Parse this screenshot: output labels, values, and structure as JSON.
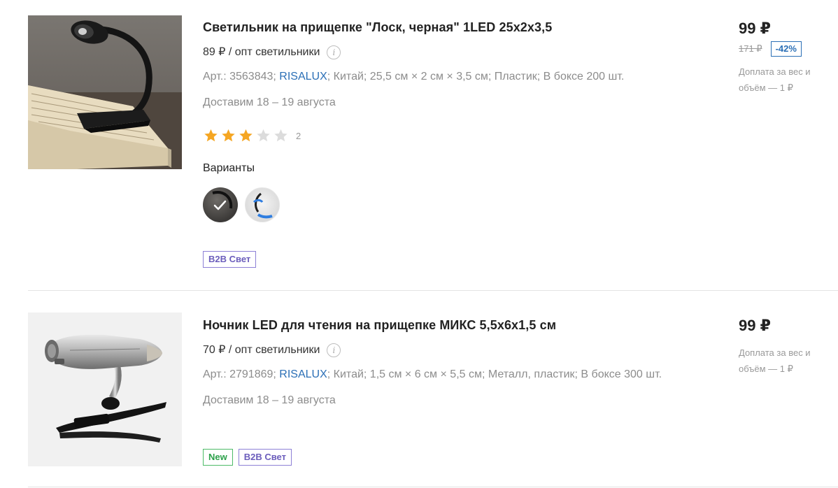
{
  "products": [
    {
      "title": "Светильник на прищепке \"Лоск, черная\" 1LED 25х2х3,5",
      "unit_price": "89 ₽ / опт светильники",
      "attrs": {
        "article": "Арт.: 3563843;",
        "brand": "RISALUX",
        "rest": "; Китай; 25,5 см × 2 см × 3,5 см; Пластик; В боксе 200 шт."
      },
      "delivery": "Доставим 18 – 19 августа",
      "rating": {
        "value": 3,
        "max": 5,
        "count": "2"
      },
      "variants_label": "Варианты",
      "variants": [
        {
          "name": "black",
          "selected": true
        },
        {
          "name": "white-blue",
          "selected": false
        }
      ],
      "tags": [
        "B2B Свет"
      ],
      "price": "99 ₽",
      "old_price": "171 ₽",
      "discount": "-42%",
      "surcharge": "Доплата за вес и объём — 1 ₽",
      "image_icon": "clip-book-lamp-black"
    },
    {
      "title": "Ночник LED для чтения на прищепке МИКС 5,5х6х1,5 см",
      "unit_price": "70 ₽ / опт светильники",
      "attrs": {
        "article": "Арт.: 2791869;",
        "brand": "RISALUX",
        "rest": "; Китай; 1,5 см × 6 см × 5,5 см; Металл, пластик; В боксе 300 шт."
      },
      "delivery": "Доставим 18 – 19 августа",
      "tags": [
        "New",
        "B2B Свет"
      ],
      "price": "99 ₽",
      "surcharge": "Доплата за вес и объём — 1 ₽",
      "image_icon": "clip-reading-light-silver"
    }
  ],
  "colors": {
    "brand_link": "#2b6fb6",
    "star_active": "#f5a623",
    "star_inactive": "#dcdcdc",
    "tag_b2b": "#6c5ebc",
    "tag_new": "#2ca14a"
  }
}
